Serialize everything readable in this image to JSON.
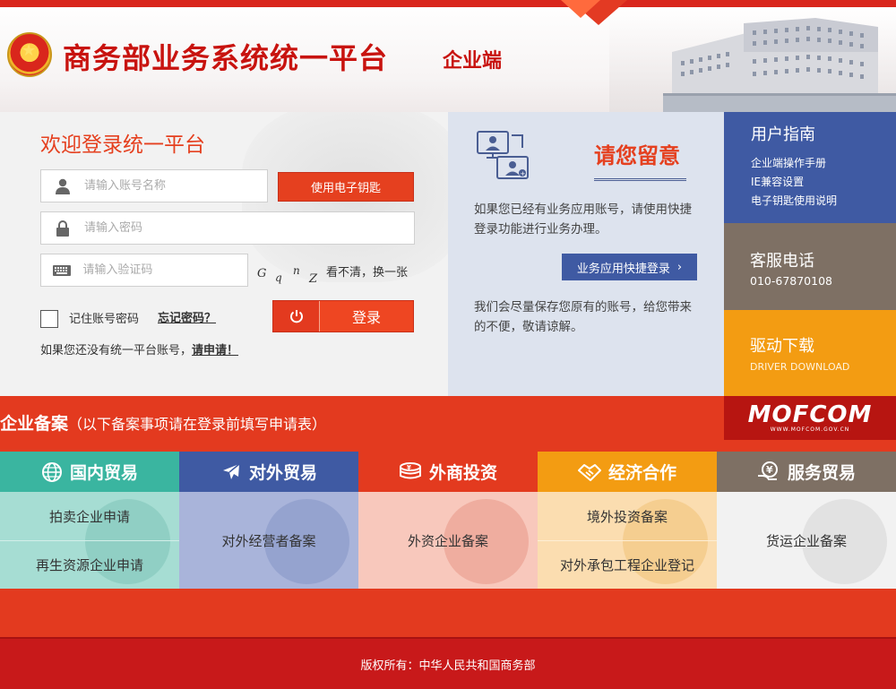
{
  "header": {
    "title": "商务部业务系统统一平台",
    "subtitle": "企业端"
  },
  "login": {
    "title": "欢迎登录统一平台",
    "username_placeholder": "请输入账号名称",
    "password_placeholder": "请输入密码",
    "captcha_placeholder": "请输入验证码",
    "ekey_button": "使用电子钥匙",
    "captcha_text": "GqnZ",
    "refresh_label": "看不清，换一张",
    "remember_label": "记住账号密码",
    "forgot_link": "忘记密码？",
    "login_button": "登录",
    "register_text": "如果您还没有统一平台账号，",
    "register_link": "请申请！"
  },
  "notice": {
    "title": "请您留意",
    "paragraph1": "如果您已经有业务应用账号，请使用快捷登录功能进行业务办理。",
    "quick_button": "业务应用快捷登录",
    "paragraph2": "我们会尽量保存您原有的账号，给您带来的不便，敬请谅解。"
  },
  "sidebar": {
    "guide_title": "用户指南",
    "guide_links": [
      "企业端操作手册",
      "IE兼容设置",
      "电子钥匙使用说明"
    ],
    "service_title": "客服电话",
    "service_phone": "010-67870108",
    "driver_title": "驱动下载",
    "driver_sub": "DRIVER DOWNLOAD"
  },
  "filing": {
    "title": "企业备案",
    "subtitle": "（以下备案事项请在登录前填写申请表）",
    "logo": "MOFCOM",
    "logo_url": "WWW.MOFCOM.GOV.CN"
  },
  "categories": [
    {
      "name": "国内贸易",
      "items": [
        "拍卖企业申请",
        "再生资源企业申请"
      ],
      "head_color": "#3ab5a0",
      "body_color": "#a6ddd3",
      "icon": "globe-icon"
    },
    {
      "name": "对外贸易",
      "items": [
        "对外经营者备案"
      ],
      "head_color": "#3f5aa3",
      "body_color": "#a9b4da",
      "icon": "airplane-icon"
    },
    {
      "name": "外商投资",
      "items": [
        "外资企业备案"
      ],
      "head_color": "#e33a1f",
      "body_color": "#f8c8bc",
      "icon": "coins-icon"
    },
    {
      "name": "经济合作",
      "items": [
        "境外投资备案",
        "对外承包工程企业登记"
      ],
      "head_color": "#f39c12",
      "body_color": "#fbddb0",
      "icon": "handshake-icon"
    },
    {
      "name": "服务贸易",
      "items": [
        "货运企业备案"
      ],
      "head_color": "#7e7064",
      "body_color": "#f2f2f2",
      "icon": "yuan-service-icon"
    }
  ],
  "footer": {
    "copyright": "版权所有：中华人民共和国商务部"
  }
}
